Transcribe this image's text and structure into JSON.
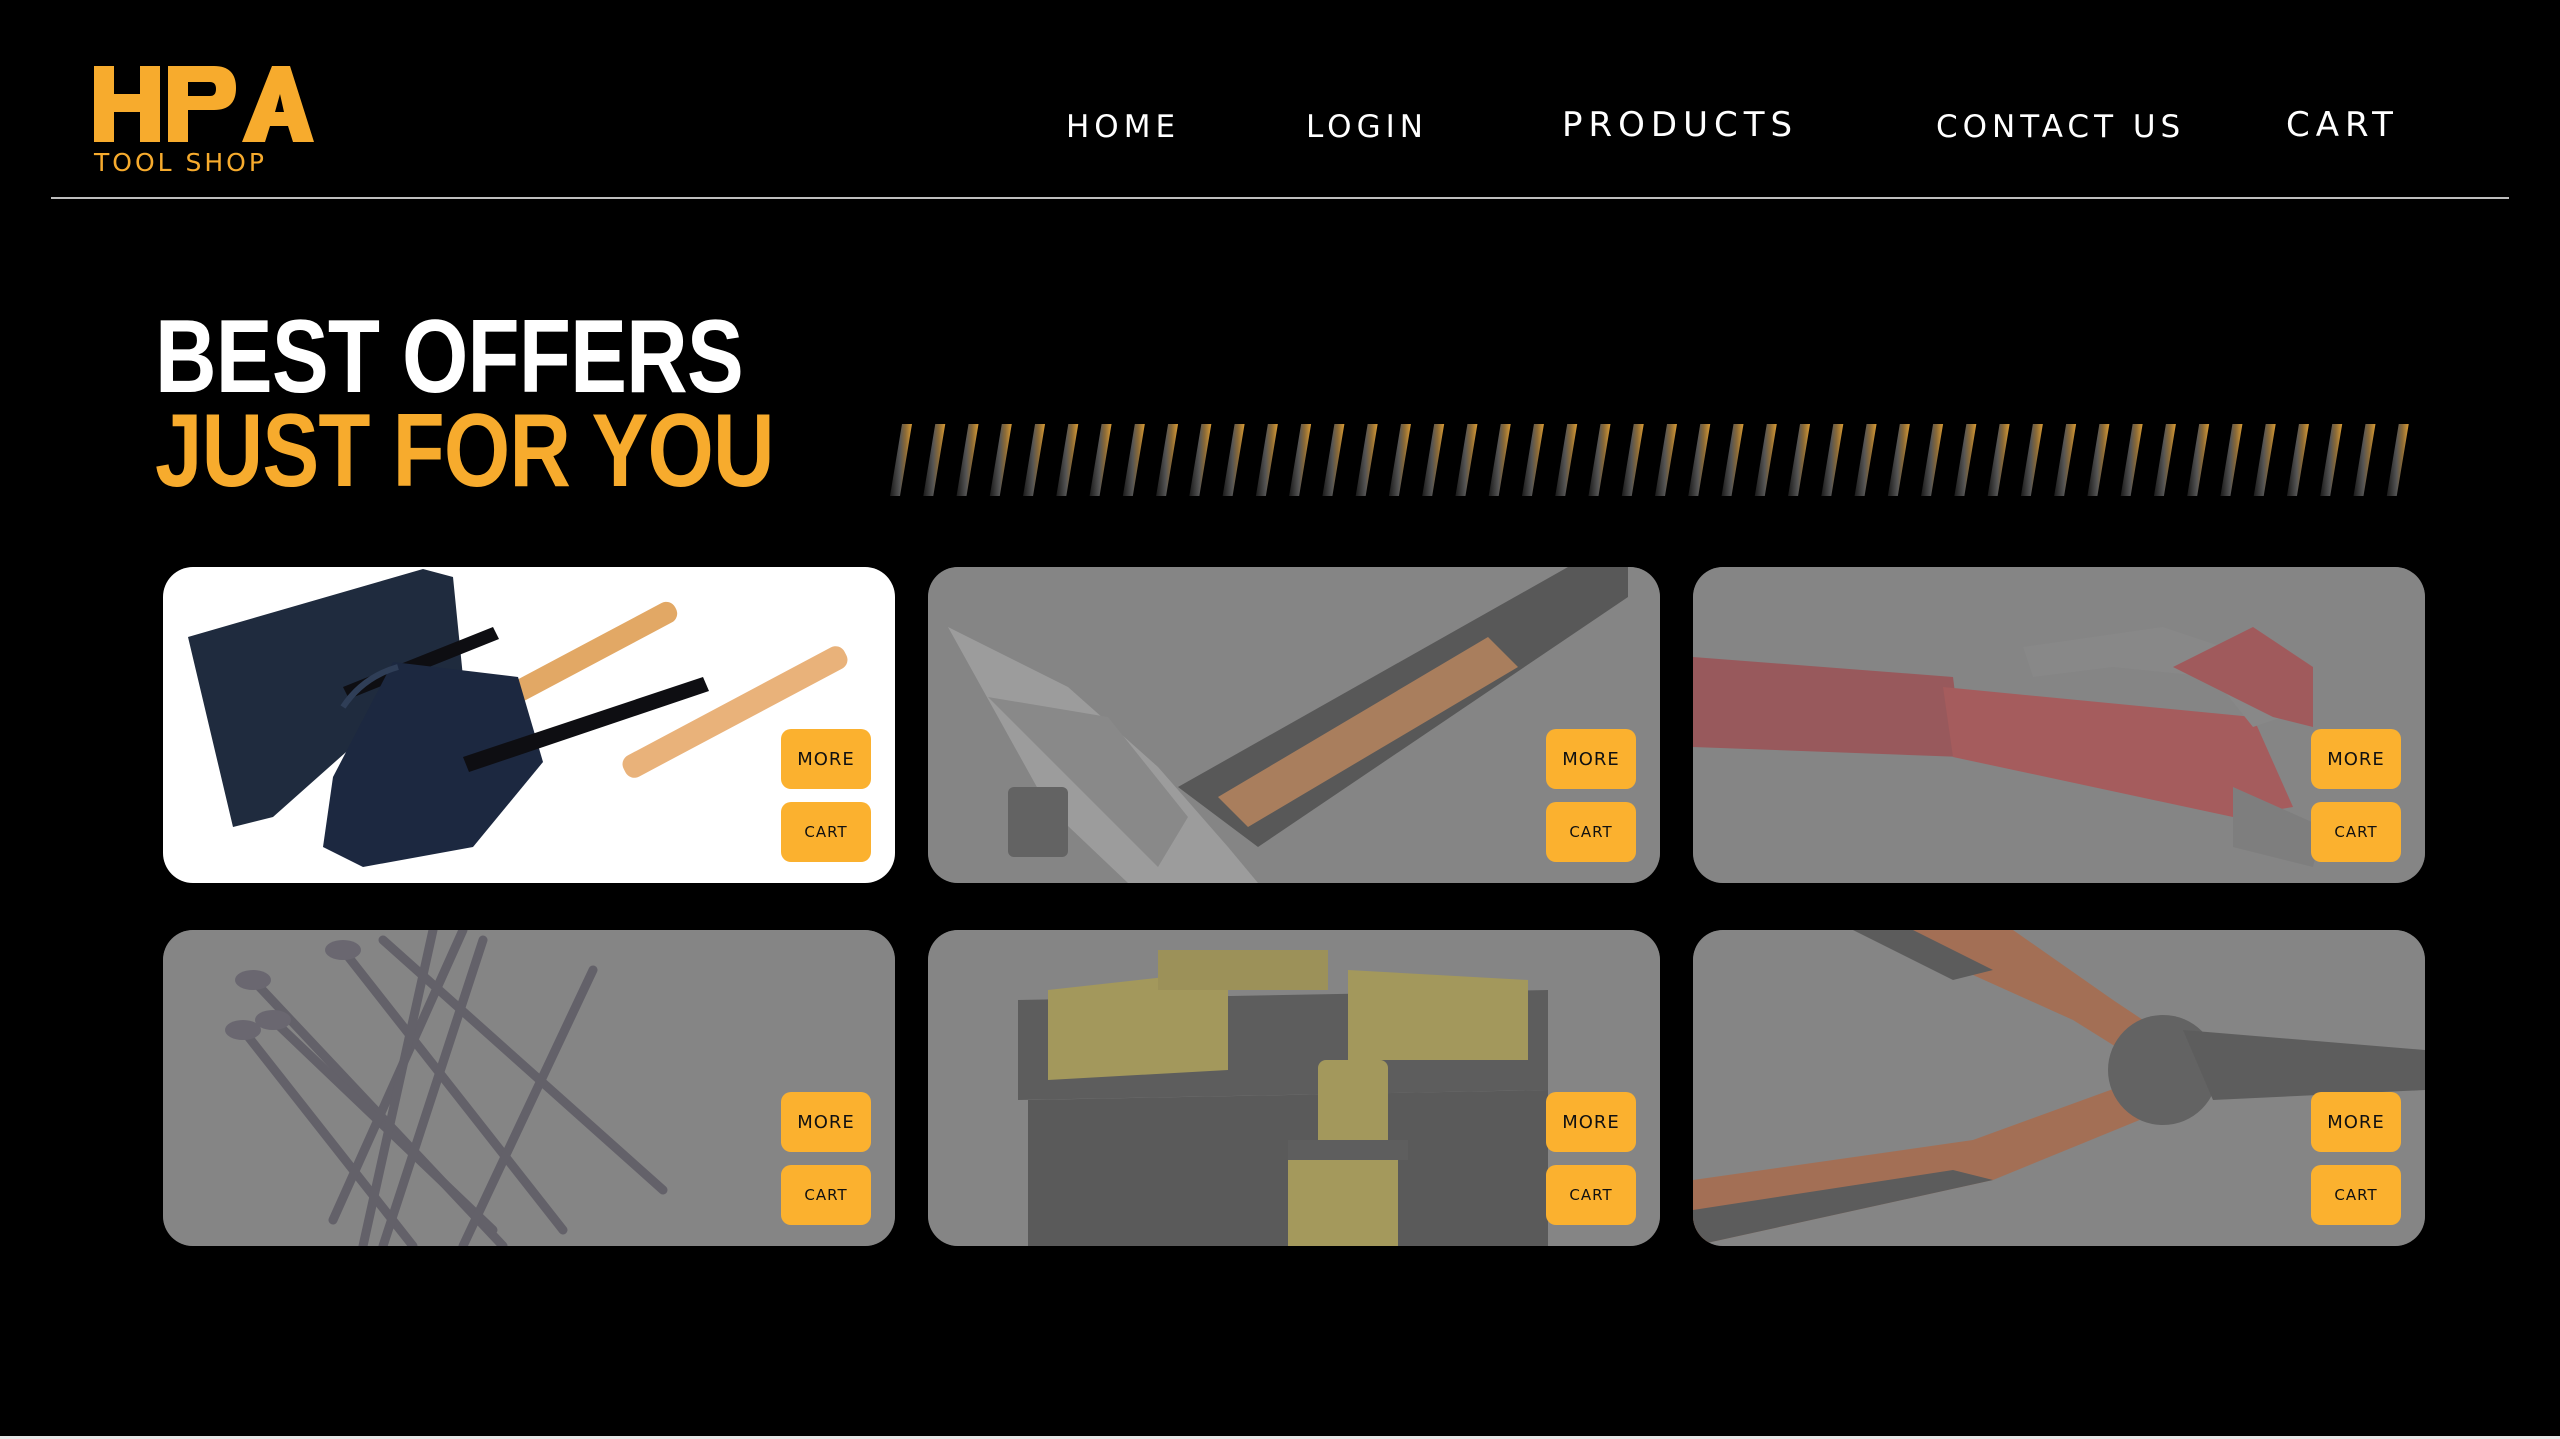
{
  "brand": {
    "mark": "HPA",
    "subtitle": "TOOL SHOP",
    "color": "#f7ab2d"
  },
  "nav": {
    "home": "HOME",
    "login": "LOGIN",
    "products": "PRODUCTS",
    "contact": "CONTACT US",
    "cart": "CART"
  },
  "hero": {
    "line1": "BEST OFFERS",
    "line2": "JUST FOR YOU"
  },
  "products": [
    {
      "icon": "shovel-image",
      "more_label": "MORE",
      "cart_label": "CART",
      "highlighted": true
    },
    {
      "icon": "hammer-image",
      "more_label": "MORE",
      "cart_label": "CART",
      "highlighted": false
    },
    {
      "icon": "pipe-wrench-image",
      "more_label": "MORE",
      "cart_label": "CART",
      "highlighted": false
    },
    {
      "icon": "nails-image",
      "more_label": "MORE",
      "cart_label": "CART",
      "highlighted": false
    },
    {
      "icon": "toolbox-image",
      "more_label": "MORE",
      "cart_label": "CART",
      "highlighted": false
    },
    {
      "icon": "pliers-image",
      "more_label": "MORE",
      "cart_label": "CART",
      "highlighted": false
    }
  ],
  "colors": {
    "background": "#000000",
    "accent": "#f7ab2d",
    "button": "#fbb12f",
    "card_inactive": "#858585",
    "card_active": "#ffffff"
  }
}
